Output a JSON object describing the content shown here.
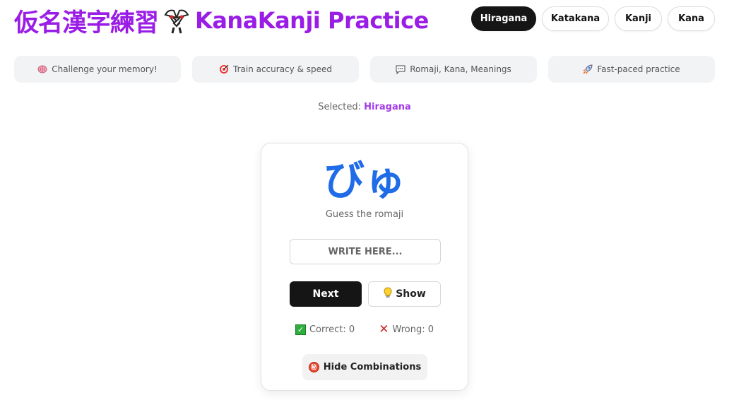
{
  "header": {
    "title_kanji": "仮名漢字練習",
    "title_latin": "KanaKanji Practice",
    "logo_icon": "crossed-fans-icon",
    "brand_color": "#9a1de6"
  },
  "tabs": [
    {
      "label": "Hiragana",
      "active": true
    },
    {
      "label": "Katakana",
      "active": false
    },
    {
      "label": "Kanji",
      "active": false
    },
    {
      "label": "Kana",
      "active": false
    }
  ],
  "features": [
    {
      "icon": "brain-icon",
      "label": "Challenge your memory!"
    },
    {
      "icon": "target-icon",
      "label": "Train accuracy & speed"
    },
    {
      "icon": "speech-bubble-icon",
      "label": "Romaji, Kana, Meanings"
    },
    {
      "icon": "rocket-icon",
      "label": "Fast-paced practice"
    }
  ],
  "selected": {
    "prefix": "Selected:",
    "value": "Hiragana",
    "accent": "#a43ae8"
  },
  "card": {
    "glyph": "びゅ",
    "glyph_color": "#1f6be8",
    "hint": "Guess the romaji",
    "input": {
      "placeholder": "WRITE HERE...",
      "value": ""
    },
    "next_label": "Next",
    "show_label": "Show",
    "show_icon": "lightbulb-icon",
    "correct_label": "Correct: 0",
    "wrong_label": "Wrong: 0",
    "combos_label": "Hide Combinations",
    "combos_icon": "secret-icon"
  }
}
